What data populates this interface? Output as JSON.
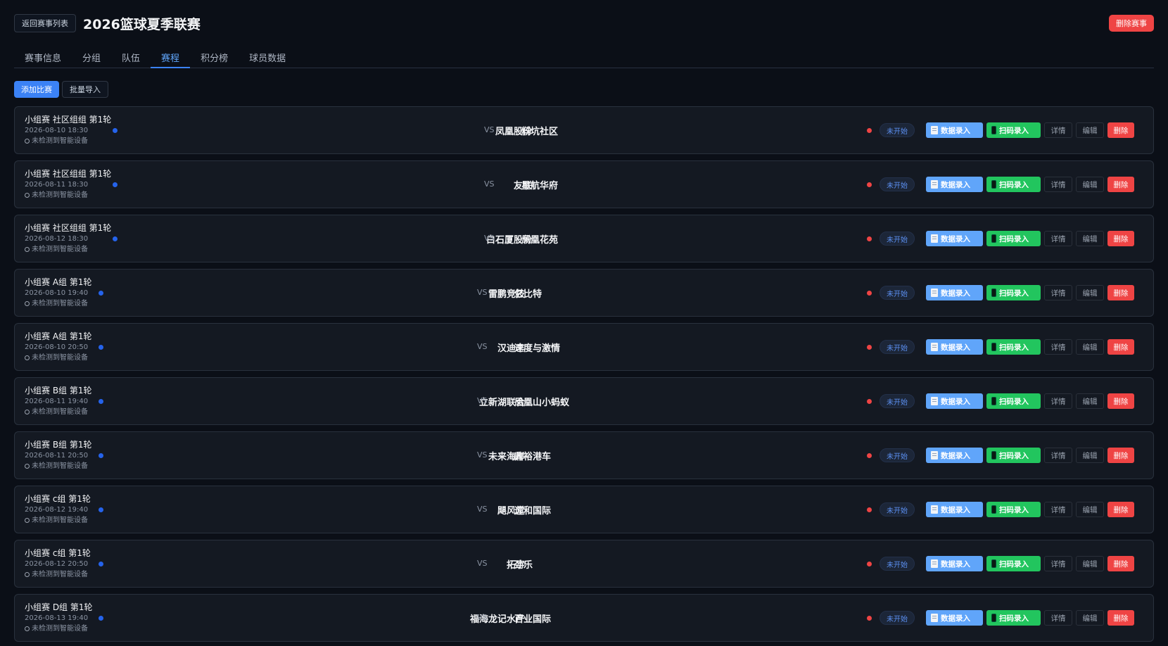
{
  "header": {
    "back_label": "返回赛事列表",
    "title": "2026篮球夏季联赛",
    "delete_label": "删除赛事"
  },
  "tabs": [
    {
      "label": "赛事信息"
    },
    {
      "label": "分组"
    },
    {
      "label": "队伍"
    },
    {
      "label": "赛程",
      "active": true
    },
    {
      "label": "积分榜"
    },
    {
      "label": "球员数据"
    }
  ],
  "toolbar": {
    "add_label": "添加比赛",
    "import_label": "批量导入"
  },
  "labels": {
    "vs": "VS",
    "device": "未检测到智能设备",
    "data_entry": "数据录入",
    "scan_entry": "扫码录入",
    "detail": "详情",
    "edit": "编辑",
    "delete": "删除"
  },
  "colors": {
    "accent": "#3b82f6",
    "danger": "#ef4444",
    "success": "#22c55e",
    "data_entry": "#60a5fa"
  },
  "matches": [
    {
      "round": "小组赛 社区组组 第1轮",
      "time": "2026-08-10 18:30",
      "home": "凤凰股份",
      "away": "料坑社区",
      "status": "未开始"
    },
    {
      "round": "小组赛 社区组组 第1轮",
      "time": "2026-08-11 18:30",
      "home": "友联",
      "away": "星航华府",
      "status": "未开始"
    },
    {
      "round": "小组赛 社区组组 第1轮",
      "time": "2026-08-12 18:30",
      "home": "白石厦股份",
      "away": "凤凰花苑",
      "status": "未开始"
    },
    {
      "round": "小组赛 A组 第1轮",
      "time": "2026-08-10 19:40",
      "home": "雷鹏竞技",
      "away": "亿比特",
      "status": "未开始"
    },
    {
      "round": "小组赛 A组 第1轮",
      "time": "2026-08-10 20:50",
      "home": "汉迪丰",
      "away": "速度与激情",
      "status": "未开始"
    },
    {
      "round": "小组赛 B组 第1轮",
      "time": "2026-08-11 19:40",
      "home": "立新湖联合",
      "away": "凤凰山小蚂蚁",
      "status": "未开始"
    },
    {
      "round": "小组赛 B组 第1轮",
      "time": "2026-08-11 20:50",
      "home": "未来海岸",
      "away": "鼎裕港车",
      "status": "未开始"
    },
    {
      "round": "小组赛 c组 第1轮",
      "time": "2026-08-12 19:40",
      "home": "飓风堂",
      "away": "远和国际",
      "status": "未开始"
    },
    {
      "round": "小组赛 c组 第1轮",
      "time": "2026-08-12 20:50",
      "home": "拓宇",
      "away": "劲乐",
      "status": "未开始"
    },
    {
      "round": "小组赛 D组 第1轮",
      "time": "2026-08-13 19:40",
      "home": "福海龙记水产",
      "away": "百业国际",
      "status": "未开始"
    }
  ]
}
